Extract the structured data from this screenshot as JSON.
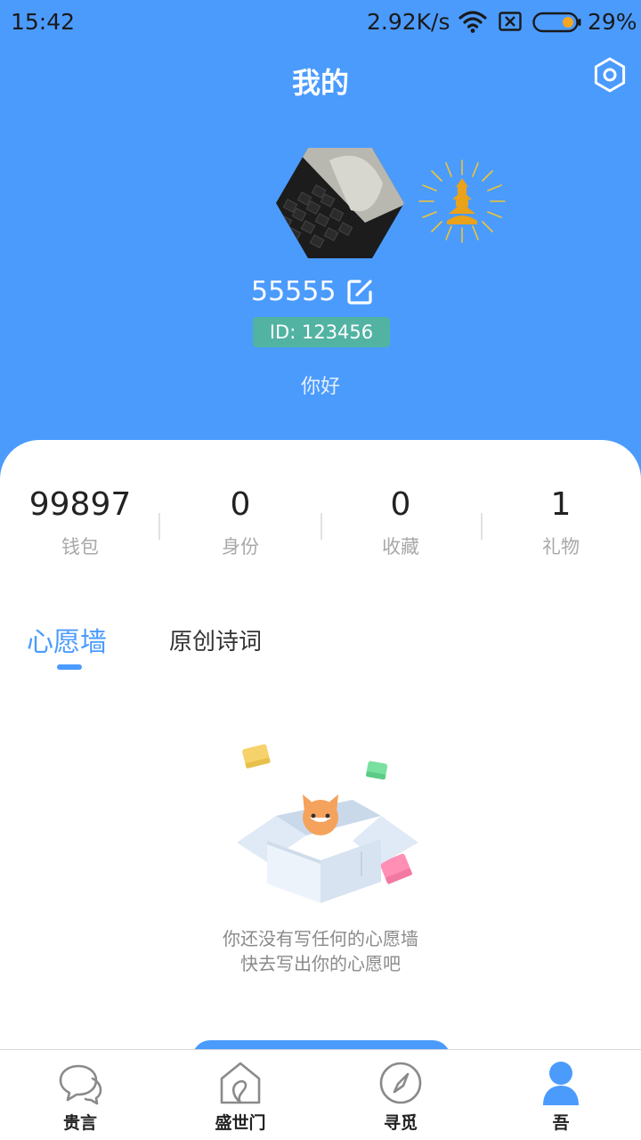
{
  "status_bar": {
    "time": "15:42",
    "speed": "2.92K/s",
    "battery": "29%",
    "icons": [
      "wifi-icon",
      "sim-icon",
      "battery-icon"
    ]
  },
  "header": {
    "title": "我的",
    "settings_icon": "gear-icon"
  },
  "profile": {
    "username": "55555",
    "id_label": "ID: 123456",
    "signature": "你好",
    "avatar": "keyboard-photo",
    "badge_icon": "golden-pagoda-badge-icon"
  },
  "stats": [
    {
      "value": "99897",
      "label": "钱包"
    },
    {
      "value": "0",
      "label": "身份"
    },
    {
      "value": "0",
      "label": "收藏"
    },
    {
      "value": "1",
      "label": "礼物"
    }
  ],
  "tabs": [
    {
      "label": "心愿墙",
      "active": true
    },
    {
      "label": "原创诗词",
      "active": false
    }
  ],
  "empty_state": {
    "line1": "你还没有写任何的心愿墙",
    "line2": "快去写出你的心愿吧"
  },
  "bottom_nav": [
    {
      "label": "贵言",
      "icon": "chat-bubbles-icon"
    },
    {
      "label": "盛世门",
      "icon": "house-icon"
    },
    {
      "label": "寻觅",
      "icon": "compass-icon"
    },
    {
      "label": "吾",
      "icon": "person-icon",
      "active": true
    }
  ],
  "colors": {
    "primary": "#4b9bfd",
    "id_badge": "#52b3a2",
    "muted_text": "#a8a8a8"
  }
}
